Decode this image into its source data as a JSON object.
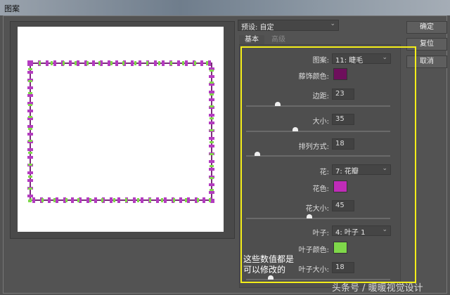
{
  "window": {
    "title": "图案"
  },
  "preset": {
    "label": "预设: 自定"
  },
  "buttons": {
    "ok": "确定",
    "reset": "复位",
    "cancel": "取消"
  },
  "tabs": [
    {
      "label": "基本",
      "active": true
    },
    {
      "label": "高级",
      "active": false
    }
  ],
  "form": {
    "pattern": {
      "label": "图案:",
      "value": "11: 睫毛"
    },
    "vine_color": {
      "label": "藤饰颜色:",
      "color": "#6e0f5c"
    },
    "margin": {
      "label": "边距:",
      "value": "23",
      "slider": 0.22
    },
    "size": {
      "label": "大小:",
      "value": "35",
      "slider": 0.34
    },
    "arrangement": {
      "label": "排列方式:",
      "value": "18",
      "slider": 0.08
    },
    "flower": {
      "label": "花:",
      "value": "7: 花瓣"
    },
    "flower_color": {
      "label": "花色:",
      "color": "#c02cb8"
    },
    "flower_size": {
      "label": "花大小:",
      "value": "45",
      "slider": 0.44
    },
    "leaf": {
      "label": "叶子:",
      "value": "4: 叶子 1"
    },
    "leaf_color": {
      "label": "叶子颜色:",
      "color": "#7fd84a"
    },
    "leaf_size": {
      "label": "叶子大小:",
      "value": "18",
      "slider": 0.17
    }
  },
  "annotation": {
    "line1": "这些数值都是",
    "line2": "可以修改的"
  },
  "watermark": "头条号 / 暖暖视觉设计"
}
